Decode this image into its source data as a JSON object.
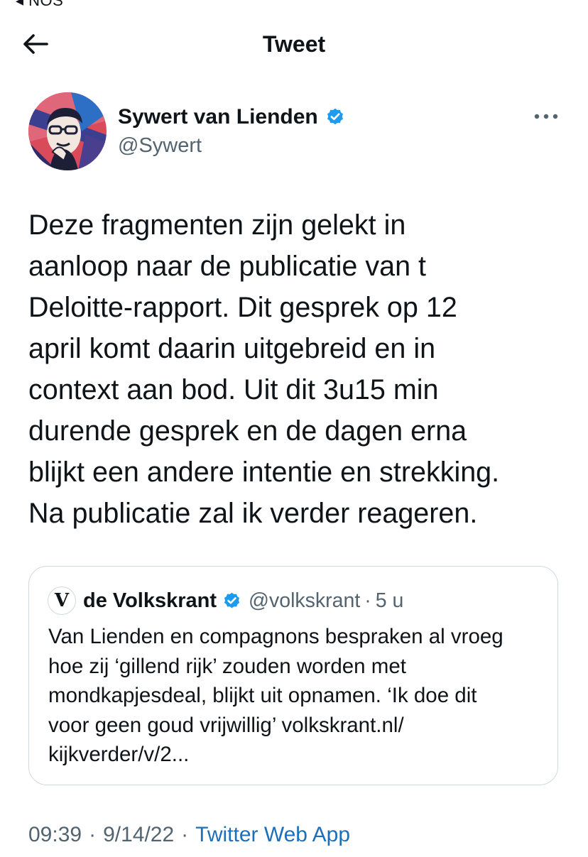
{
  "status_bar": {
    "back_label": "◂ NOS"
  },
  "header": {
    "title": "Tweet",
    "back_icon": "arrow-left-icon"
  },
  "tweet": {
    "author": {
      "name": "Sywert van Lienden",
      "handle": "@Sywert",
      "verified": true
    },
    "text_lines": [
      "Deze fragmenten zijn gelekt in",
      "aanloop naar de publicatie van t",
      "Deloitte-rapport. Dit gesprek op 12",
      "april komt daarin uitgebreid en in",
      "context aan bod. Uit dit 3u15 min",
      "durende gesprek en de dagen erna",
      "blijkt een andere intentie en strekking.",
      "Na publicatie zal ik verder reageren."
    ],
    "time": "09:39",
    "date": "9/14/22",
    "source": "Twitter Web App",
    "separator": "·"
  },
  "quote": {
    "avatar_letter": "V",
    "name": "de Volkskrant",
    "handle": "@volkskrant",
    "separator": "·",
    "time": "5 u",
    "verified": true,
    "text_lines": [
      "Van Lienden en compagnons bespraken al vroeg",
      "hoe zij ‘gillend rijk’ zouden worden met",
      "mondkapjesdeal, blijkt uit opnamen. ‘Ik doe dit",
      "voor geen goud vrijwillig’ volkskrant.nl/",
      "kijkverder/v/2..."
    ]
  },
  "colors": {
    "text": "#0f1419",
    "secondary": "#536471",
    "verified": "#1d9bf0",
    "link": "#1d6fb8",
    "border": "#cfd9de"
  }
}
